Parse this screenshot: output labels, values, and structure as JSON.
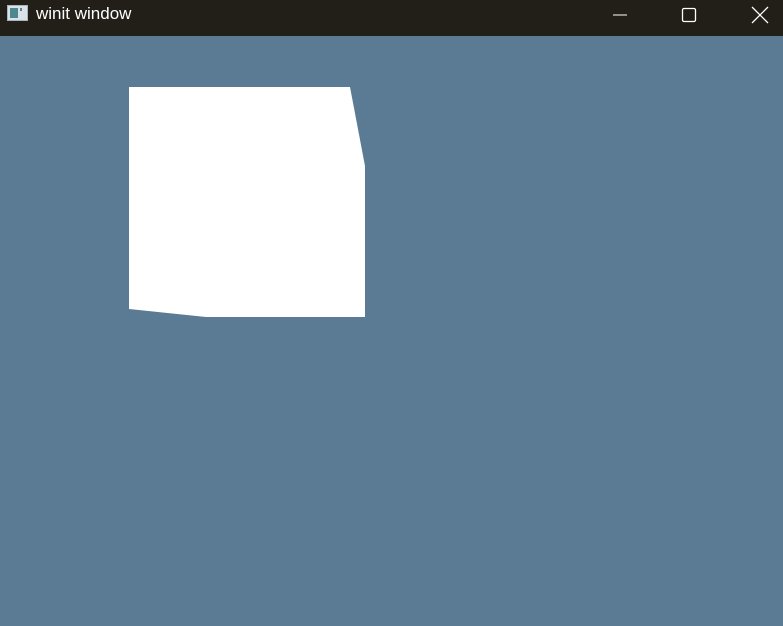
{
  "window": {
    "title": "winit window"
  },
  "colors": {
    "titlebar": "#221f19",
    "background": "#5a7b93",
    "shape": "#ffffff"
  },
  "icons": {
    "app": "application-icon",
    "minimize": "minimize-icon",
    "maximize": "maximize-icon",
    "close": "close-icon"
  }
}
